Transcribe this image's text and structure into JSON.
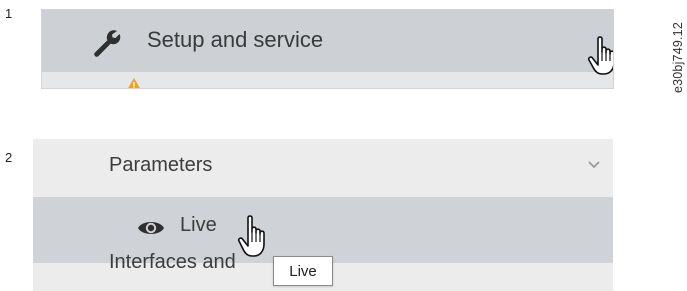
{
  "step1": {
    "number": "1",
    "menu_label": "Setup and service",
    "icons": {
      "tool": "wrench-icon",
      "cursor": "hand-pointer-icon",
      "alert": "warning-icon"
    }
  },
  "step2": {
    "number": "2",
    "parameters_label": "Parameters",
    "live_label": "Live",
    "tooltip_text": "Live",
    "interfaces_label": "Interfaces and",
    "icons": {
      "expand": "chevron-down-icon",
      "view": "eye-icon",
      "cursor": "hand-pointer-icon"
    }
  },
  "figure_id": "e30bj749.12",
  "colors": {
    "menu_row_selected": "#cdd0d4",
    "panel_background": "#ececed",
    "warning": "#f0a020",
    "text": "#3a3a3a"
  }
}
